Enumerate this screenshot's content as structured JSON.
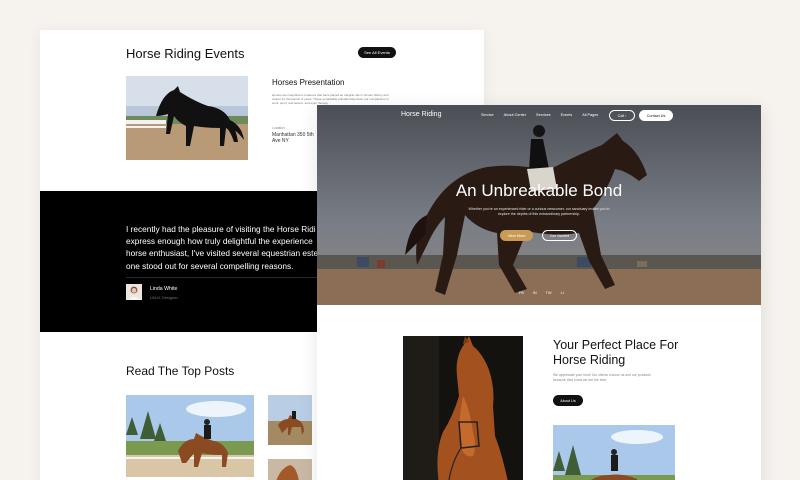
{
  "events": {
    "title": "Horse Riding Events",
    "see_all_label": "See All Events",
    "presentation_title": "Horses Presentation",
    "presentation_text": "Horses are magnificent creatures that have played an integral role in human history and culture for thousands of years. These remarkable animals have been our companions in work, sport, and leisure, and even therapy.",
    "location_label": "Location",
    "location_value": "Manhattan 350 5th Ave NY"
  },
  "testimonial": {
    "quote_lines": [
      "I recently had the pleasure of visiting the Horse Ridi",
      "express enough how truly delightful the experience",
      "horse enthusiast, I've visited several equestrian este",
      "one stood out for several compelling reasons."
    ],
    "author_name": "Linda White",
    "author_role": "UI/UX Designer"
  },
  "posts": {
    "title": "Read The Top Posts"
  },
  "front": {
    "nav": {
      "brand": "Horse Riding",
      "links": [
        "Service",
        "About Center",
        "Services",
        "Events",
        "All Pages"
      ],
      "call_label": "Call",
      "contact_label": "Contact Us"
    },
    "hero": {
      "title": "An Unbreakable Bond",
      "subtitle": "Whether you're an experienced rider or a curious newcomer, our sanctuary invites you to explore the depths of this extraordinary partnership.",
      "primary_button": "View More",
      "secondary_button": "Get Started",
      "social": [
        "FB",
        "IN",
        "TW",
        "LI"
      ]
    },
    "about": {
      "title": "Your Perfect Place For Horse Riding",
      "text": "We appreciate your trust! Our clients choose us and our products because they know we are the best.",
      "button": "About Us"
    }
  },
  "colors": {
    "page_background": "#f6f3ef",
    "dark_section": "#000000",
    "accent_gold": "#c99b56",
    "text_dark": "#111111"
  }
}
